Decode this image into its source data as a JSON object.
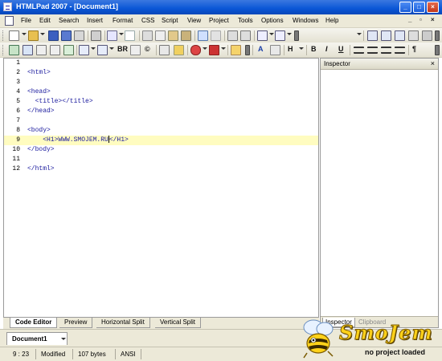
{
  "window": {
    "title": "HTMLPad 2007 - [Document1]"
  },
  "menu": [
    "File",
    "Edit",
    "Search",
    "Insert",
    "Format",
    "CSS",
    "Script",
    "View",
    "Project",
    "Tools",
    "Options",
    "Windows",
    "Help"
  ],
  "toolbar2": {
    "br_label": "BR",
    "bold_label": "B",
    "italic_label": "I",
    "underline_label": "U",
    "h_label": "H",
    "a_label": "A"
  },
  "editor": {
    "lines": [
      {
        "num": "1",
        "code": ""
      },
      {
        "num": "2",
        "code": "<html>"
      },
      {
        "num": "3",
        "code": ""
      },
      {
        "num": "4",
        "code": "<head>"
      },
      {
        "num": "5",
        "code": "  <title></title>"
      },
      {
        "num": "6",
        "code": "</head>"
      },
      {
        "num": "7",
        "code": ""
      },
      {
        "num": "8",
        "code": "<body>"
      },
      {
        "num": "9",
        "code_before": "    <H1>WWW.SMOJEM.RU",
        "code_after": "</H1>"
      },
      {
        "num": "10",
        "code": "</body>"
      },
      {
        "num": "11",
        "code": ""
      },
      {
        "num": "12",
        "code": "</html>"
      }
    ]
  },
  "inspector": {
    "title": "Inspector",
    "tabs": [
      "Inspector",
      "Clipboard"
    ]
  },
  "editor_tabs": [
    "Code Editor",
    "Preview",
    "Horizontal Split",
    "Vertical Split"
  ],
  "document_tab": "Document1",
  "status": {
    "position": "9 : 23",
    "state": "Modified",
    "size": "107 bytes",
    "encoding": "ANSI"
  },
  "logo": {
    "brand": "SmoJem",
    "tagline": "no project loaded"
  },
  "colors": {
    "title_bar": "#0a56d6",
    "code_blue": "#1b1b9e",
    "highlight": "#fffcc0",
    "logo_yellow": "#ffd21a"
  }
}
